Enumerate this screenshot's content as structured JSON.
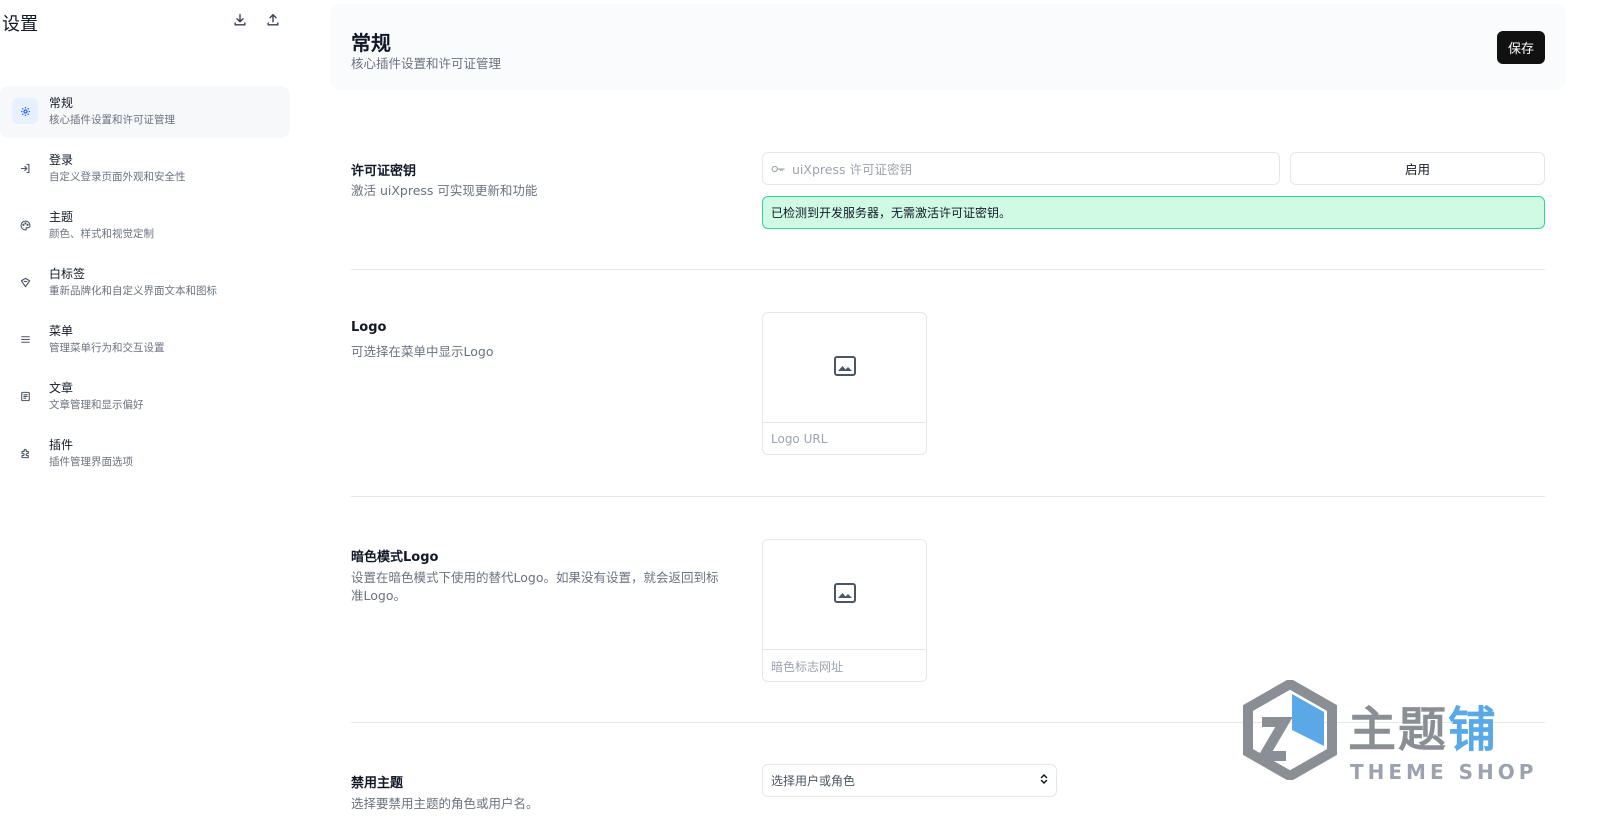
{
  "sidebar": {
    "title": "设置",
    "actions": [
      {
        "icon": "download-icon"
      },
      {
        "icon": "upload-icon"
      }
    ],
    "items": [
      {
        "label": "常规",
        "desc": "核心插件设置和许可证管理",
        "icon": "gear-icon",
        "active": true
      },
      {
        "label": "登录",
        "desc": "自定义登录页面外观和安全性",
        "icon": "login-icon"
      },
      {
        "label": "主题",
        "desc": "颜色、样式和视觉定制",
        "icon": "palette-icon"
      },
      {
        "label": "白标签",
        "desc": "重新品牌化和自定义界面文本和图标",
        "icon": "tag-icon"
      },
      {
        "label": "菜单",
        "desc": "管理菜单行为和交互设置",
        "icon": "menu-icon"
      },
      {
        "label": "文章",
        "desc": "文章管理和显示偏好",
        "icon": "document-icon"
      },
      {
        "label": "插件",
        "desc": "插件管理界面选项",
        "icon": "plugin-icon"
      }
    ]
  },
  "header": {
    "title": "常规",
    "subtitle": "核心插件设置和许可证管理",
    "save_label": "保存"
  },
  "license": {
    "label": "许可证密钥",
    "desc": "激活 uiXpress 可实现更新和功能",
    "placeholder": "uiXpress 许可证密钥",
    "activate_label": "启用",
    "notice": "已检测到开发服务器，无需激活许可证密钥。"
  },
  "logo": {
    "label": "Logo",
    "desc": "可选择在菜单中显示Logo",
    "url_placeholder": "Logo URL"
  },
  "dark_logo": {
    "label": "暗色模式Logo",
    "desc": "设置在暗色模式下使用的替代Logo。如果没有设置，就会返回到标准Logo。",
    "url_placeholder": "暗色标志网址"
  },
  "disable_theme": {
    "label": "禁用主题",
    "desc": "选择要禁用主题的角色或用户名。",
    "select_placeholder": "选择用户或角色"
  },
  "watermark": {
    "text_main": "主题",
    "text_accent": "铺",
    "text_sub": "THEME SHOP"
  },
  "colors": {
    "accent": "#2563eb",
    "notice_bg": "#d1fae5",
    "notice_border": "#34d399",
    "save_bg": "#111111"
  }
}
